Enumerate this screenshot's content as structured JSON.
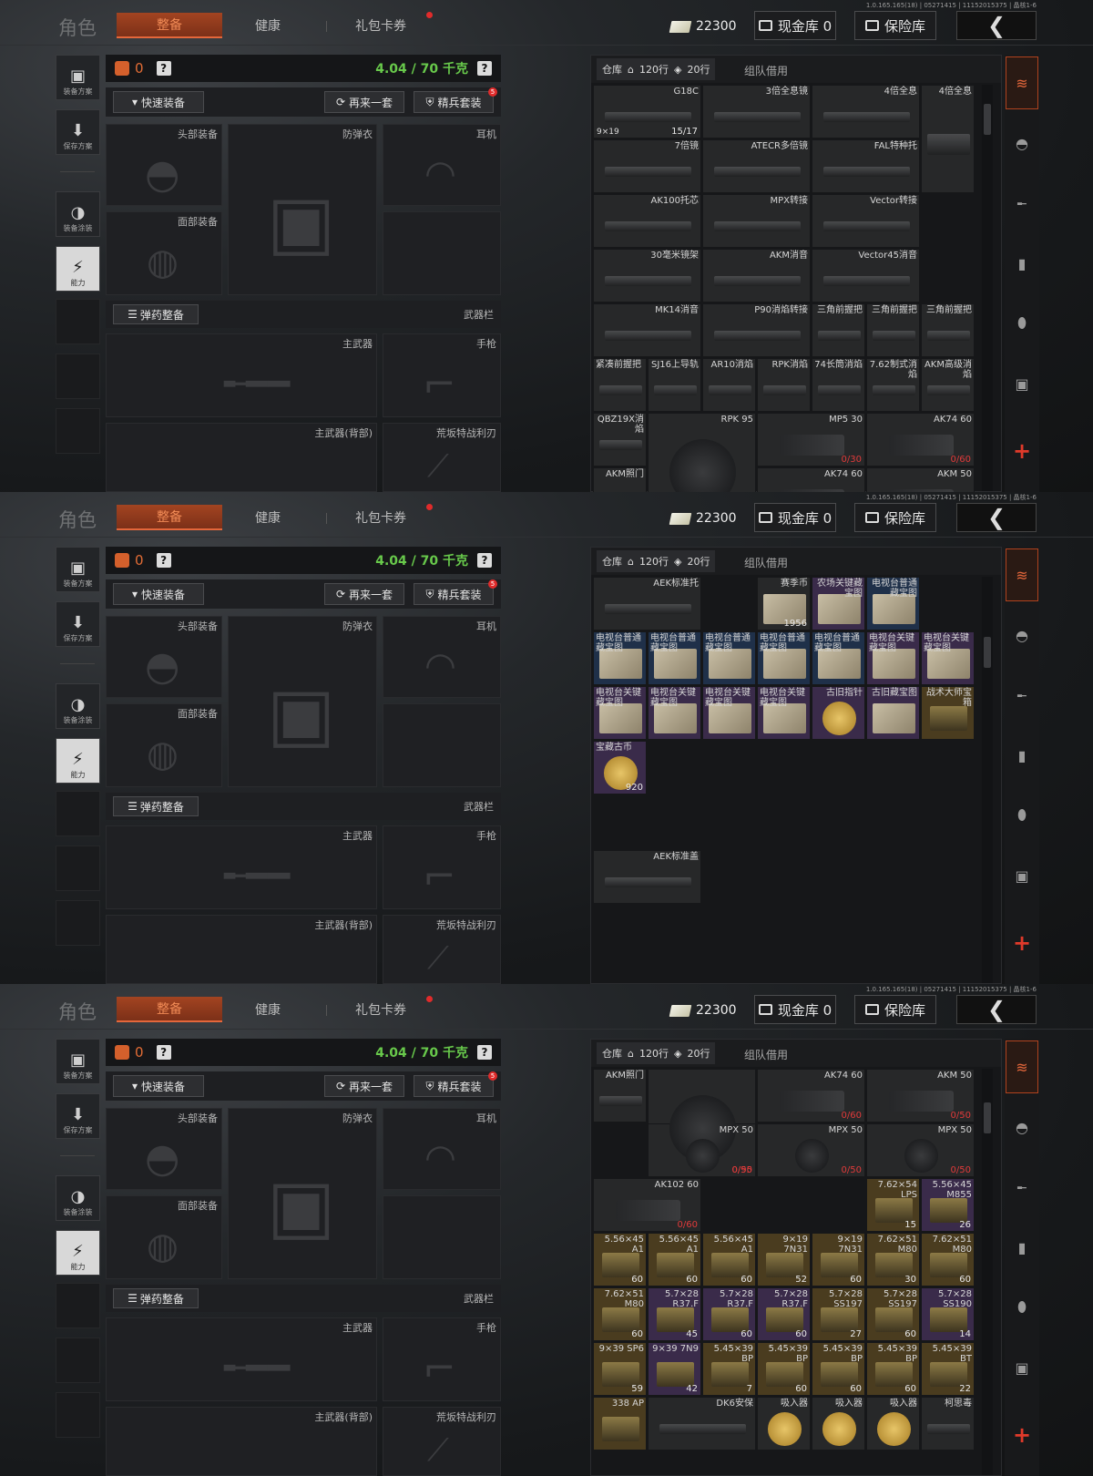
{
  "build_info": "1.0.165.165(18) | 05271415 | 11152015375 | 晶核1-6",
  "header": {
    "title": "角色",
    "tabs": [
      {
        "label": "整备",
        "active": true
      },
      {
        "label": "健康",
        "active": false
      },
      {
        "label": "礼包卡券",
        "active": false,
        "dot": true
      }
    ],
    "money": "22300",
    "cash_vault": "现金库 0",
    "insurance": "保险库",
    "back_icon": "chevron-left-icon"
  },
  "left_menu": {
    "items": [
      "装备方案",
      "保存方案",
      "装备涂装",
      "能力"
    ]
  },
  "loadout": {
    "bag_count": "0",
    "help": "?",
    "weight": "4.04 / 70 千克",
    "quick_equip": "快速装备",
    "repeat": "再来一套",
    "elite_set": "精兵套装",
    "elite_badge": "5",
    "slots": {
      "head": "头部装备",
      "armor": "防弹衣",
      "ear": "耳机",
      "face": "面部装备"
    },
    "ammo_btn": "弹药整备",
    "weapon_bar": "武器栏",
    "primary": "主武器",
    "pistol": "手枪",
    "primary_back": "主武器(背部)",
    "melee": "荒坂特战利刃"
  },
  "stash": {
    "tab": "仓库",
    "rows120": "120行",
    "rows20": "20行",
    "team": "组队借用"
  },
  "screens": [
    {
      "scroll": 0.05,
      "cells": [
        {
          "c": 0,
          "r": 0,
          "w": 2,
          "h": 1,
          "name": "G18C",
          "left": "9×19",
          "count": "15/17",
          "k": "gun"
        },
        {
          "c": 2,
          "r": 0,
          "w": 2,
          "h": 1,
          "name": "3倍全息镜",
          "k": "gun"
        },
        {
          "c": 4,
          "r": 0,
          "w": 2,
          "h": 1,
          "name": "4倍全息",
          "k": "gun"
        },
        {
          "c": 6,
          "r": 0,
          "w": 1,
          "h": 2,
          "name": "4倍全息",
          "k": "gun"
        },
        {
          "c": 0,
          "r": 1,
          "w": 2,
          "h": 1,
          "name": "7倍镜",
          "k": "gun"
        },
        {
          "c": 2,
          "r": 1,
          "w": 2,
          "h": 1,
          "name": "ATECR多倍镜",
          "k": "gun"
        },
        {
          "c": 4,
          "r": 1,
          "w": 2,
          "h": 1,
          "name": "FAL特种托",
          "k": "gun"
        },
        {
          "c": 0,
          "r": 2,
          "w": 2,
          "h": 1,
          "name": "AK100托芯",
          "k": "gun"
        },
        {
          "c": 2,
          "r": 2,
          "w": 2,
          "h": 1,
          "name": "MPX转接",
          "k": "gun"
        },
        {
          "c": 4,
          "r": 2,
          "w": 2,
          "h": 1,
          "name": "Vector转接",
          "k": "gun"
        },
        {
          "c": 0,
          "r": 3,
          "w": 2,
          "h": 1,
          "name": "30毫米镜架",
          "k": "gun"
        },
        {
          "c": 2,
          "r": 3,
          "w": 2,
          "h": 1,
          "name": "AKM消音",
          "k": "gun"
        },
        {
          "c": 4,
          "r": 3,
          "w": 2,
          "h": 1,
          "name": "Vector45消音",
          "k": "gun"
        },
        {
          "c": 0,
          "r": 4,
          "w": 2,
          "h": 1,
          "name": "MK14消音",
          "k": "gun"
        },
        {
          "c": 2,
          "r": 4,
          "w": 2,
          "h": 1,
          "name": "P90消焰转接",
          "k": "gun"
        },
        {
          "c": 4,
          "r": 4,
          "w": 1,
          "h": 1,
          "name": "三角前握把",
          "k": "gun"
        },
        {
          "c": 5,
          "r": 4,
          "w": 1,
          "h": 1,
          "name": "三角前握把",
          "k": "gun"
        },
        {
          "c": 6,
          "r": 4,
          "w": 1,
          "h": 1,
          "name": "三角前握把",
          "k": "gun"
        },
        {
          "c": 0,
          "r": 5,
          "w": 1,
          "h": 1,
          "name": "紧凑前握把",
          "k": "gun",
          "nl": true
        },
        {
          "c": 1,
          "r": 5,
          "w": 1,
          "h": 1,
          "name": "SJ16上导轨",
          "k": "gun"
        },
        {
          "c": 2,
          "r": 5,
          "w": 1,
          "h": 1,
          "name": "AR10消焰",
          "k": "gun"
        },
        {
          "c": 3,
          "r": 5,
          "w": 1,
          "h": 1,
          "name": "RPK消焰",
          "k": "gun"
        },
        {
          "c": 4,
          "r": 5,
          "w": 1,
          "h": 1,
          "name": "74长筒消焰",
          "k": "gun"
        },
        {
          "c": 5,
          "r": 5,
          "w": 1,
          "h": 1,
          "name": "7.62制式消焰",
          "k": "gun"
        },
        {
          "c": 6,
          "r": 5,
          "w": 1,
          "h": 1,
          "name": "AKM高级消焰",
          "k": "gun"
        },
        {
          "c": 0,
          "r": 6,
          "w": 1,
          "h": 1,
          "name": "QBZ19X消焰",
          "k": "gun"
        },
        {
          "c": 1,
          "r": 6,
          "w": 2,
          "h": 2,
          "name": "RPK 95",
          "k": "drum"
        },
        {
          "c": 3,
          "r": 6,
          "w": 2,
          "h": 1,
          "name": "MP5 30",
          "count": "0/30",
          "red": true,
          "k": "mag"
        },
        {
          "c": 5,
          "r": 6,
          "w": 2,
          "h": 1,
          "name": "AK74 60",
          "count": "0/60",
          "red": true,
          "k": "mag"
        },
        {
          "c": 0,
          "r": 7,
          "w": 1,
          "h": 1,
          "name": "AKM照门",
          "k": "gun"
        },
        {
          "c": 3,
          "r": 7,
          "w": 2,
          "h": 1,
          "name": "AK74 60",
          "k": "mag"
        },
        {
          "c": 5,
          "r": 7,
          "w": 2,
          "h": 1,
          "name": "AKM 50",
          "k": "mag"
        }
      ]
    },
    {
      "scroll": 0.16,
      "cells": [
        {
          "c": 0,
          "r": 0,
          "w": 2,
          "h": 1,
          "name": "AEK标准托",
          "k": "gun"
        },
        {
          "c": 3,
          "r": 0,
          "w": 1,
          "h": 1,
          "name": "赛季币",
          "count": "1956",
          "k": "map"
        },
        {
          "c": 4,
          "r": 0,
          "w": 1,
          "h": 1,
          "name": "农场关键藏宝图",
          "k": "map",
          "t": "purple"
        },
        {
          "c": 5,
          "r": 0,
          "w": 1,
          "h": 1,
          "name": "电视台普通藏宝图",
          "k": "map",
          "t": "blue"
        },
        {
          "c": 0,
          "r": 1,
          "w": 1,
          "h": 1,
          "name": "电视台普通藏宝图",
          "k": "map",
          "t": "blue",
          "nl": true
        },
        {
          "c": 1,
          "r": 1,
          "w": 1,
          "h": 1,
          "name": "电视台普通藏宝图",
          "k": "map",
          "t": "blue",
          "nl": true
        },
        {
          "c": 2,
          "r": 1,
          "w": 1,
          "h": 1,
          "name": "电视台普通藏宝图",
          "k": "map",
          "t": "blue",
          "nl": true
        },
        {
          "c": 3,
          "r": 1,
          "w": 1,
          "h": 1,
          "name": "电视台普通藏宝图",
          "k": "map",
          "t": "blue",
          "nl": true
        },
        {
          "c": 4,
          "r": 1,
          "w": 1,
          "h": 1,
          "name": "电视台普通藏宝图",
          "k": "map",
          "t": "blue",
          "nl": true
        },
        {
          "c": 5,
          "r": 1,
          "w": 1,
          "h": 1,
          "name": "电视台关键藏宝图",
          "k": "map",
          "t": "purple",
          "nl": true
        },
        {
          "c": 6,
          "r": 1,
          "w": 1,
          "h": 1,
          "name": "电视台关键藏宝图",
          "k": "map",
          "t": "purple",
          "nl": true
        },
        {
          "c": 0,
          "r": 2,
          "w": 1,
          "h": 1,
          "name": "电视台关键藏宝图",
          "k": "map",
          "t": "purple",
          "nl": true
        },
        {
          "c": 1,
          "r": 2,
          "w": 1,
          "h": 1,
          "name": "电视台关键藏宝图",
          "k": "map",
          "t": "purple",
          "nl": true
        },
        {
          "c": 2,
          "r": 2,
          "w": 1,
          "h": 1,
          "name": "电视台关键藏宝图",
          "k": "map",
          "t": "purple",
          "nl": true
        },
        {
          "c": 3,
          "r": 2,
          "w": 1,
          "h": 1,
          "name": "电视台关键藏宝图",
          "k": "map",
          "t": "purple",
          "nl": true
        },
        {
          "c": 4,
          "r": 2,
          "w": 1,
          "h": 1,
          "name": "古旧指针",
          "k": "coin",
          "t": "purple"
        },
        {
          "c": 5,
          "r": 2,
          "w": 1,
          "h": 1,
          "name": "古旧藏宝图",
          "k": "map",
          "t": "purple"
        },
        {
          "c": 6,
          "r": 2,
          "w": 1,
          "h": 1,
          "name": "战术大师宝箱",
          "k": "ammo",
          "t": "gold"
        },
        {
          "c": 0,
          "r": 3,
          "w": 1,
          "h": 1,
          "name": "宝藏古币",
          "count": "920",
          "k": "coin",
          "t": "purple",
          "nl": true
        },
        {
          "c": 0,
          "r": 5,
          "w": 2,
          "h": 1,
          "name": "AEK标准盖",
          "k": "gun"
        }
      ]
    },
    {
      "scroll": 0.09,
      "cells": [
        {
          "c": 1,
          "r": 0,
          "w": 2,
          "h": 2,
          "name": "",
          "count": "0/95",
          "red": true,
          "k": "drum"
        },
        {
          "c": 3,
          "r": 0,
          "w": 2,
          "h": 1,
          "name": "AK74 60",
          "count": "0/60",
          "red": true,
          "k": "mag"
        },
        {
          "c": 5,
          "r": 0,
          "w": 2,
          "h": 1,
          "name": "AKM 50",
          "count": "0/50",
          "red": true,
          "k": "mag"
        },
        {
          "c": 0,
          "r": 0,
          "w": 1,
          "h": 1,
          "name": "AKM照门",
          "k": "gun"
        },
        {
          "c": 1,
          "r": 1,
          "w": 2,
          "h": 1,
          "name": "MPX 50",
          "count": "0/50",
          "red": true,
          "k": "drum"
        },
        {
          "c": 3,
          "r": 1,
          "w": 2,
          "h": 1,
          "name": "MPX 50",
          "count": "0/50",
          "red": true,
          "k": "drum"
        },
        {
          "c": 5,
          "r": 1,
          "w": 2,
          "h": 1,
          "name": "MPX 50",
          "count": "0/50",
          "red": true,
          "k": "drum"
        },
        {
          "c": 0,
          "r": 2,
          "w": 2,
          "h": 1,
          "name": "AK102 60",
          "count": "0/60",
          "red": true,
          "k": "mag"
        },
        {
          "c": 5,
          "r": 2,
          "w": 1,
          "h": 1,
          "name": "7.62×54 LPS",
          "count": "15",
          "k": "ammo",
          "t": "gold"
        },
        {
          "c": 6,
          "r": 2,
          "w": 1,
          "h": 1,
          "name": "5.56×45 M855",
          "count": "26",
          "k": "ammo",
          "t": "purple"
        },
        {
          "c": 0,
          "r": 3,
          "w": 1,
          "h": 1,
          "name": "5.56×45 A1",
          "count": "60",
          "k": "ammo",
          "t": "gold"
        },
        {
          "c": 1,
          "r": 3,
          "w": 1,
          "h": 1,
          "name": "5.56×45 A1",
          "count": "60",
          "k": "ammo",
          "t": "gold"
        },
        {
          "c": 2,
          "r": 3,
          "w": 1,
          "h": 1,
          "name": "5.56×45 A1",
          "count": "60",
          "k": "ammo",
          "t": "gold"
        },
        {
          "c": 3,
          "r": 3,
          "w": 1,
          "h": 1,
          "name": "9×19 7N31",
          "count": "52",
          "k": "ammo",
          "t": "gold"
        },
        {
          "c": 4,
          "r": 3,
          "w": 1,
          "h": 1,
          "name": "9×19 7N31",
          "count": "60",
          "k": "ammo",
          "t": "gold"
        },
        {
          "c": 5,
          "r": 3,
          "w": 1,
          "h": 1,
          "name": "7.62×51 M80",
          "count": "30",
          "k": "ammo",
          "t": "gold"
        },
        {
          "c": 6,
          "r": 3,
          "w": 1,
          "h": 1,
          "name": "7.62×51 M80",
          "count": "60",
          "k": "ammo",
          "t": "gold"
        },
        {
          "c": 0,
          "r": 4,
          "w": 1,
          "h": 1,
          "name": "7.62×51 M80",
          "count": "60",
          "k": "ammo",
          "t": "gold"
        },
        {
          "c": 1,
          "r": 4,
          "w": 1,
          "h": 1,
          "name": "5.7×28 R37.F",
          "count": "45",
          "k": "ammo",
          "t": "purple"
        },
        {
          "c": 2,
          "r": 4,
          "w": 1,
          "h": 1,
          "name": "5.7×28 R37.F",
          "count": "60",
          "k": "ammo",
          "t": "purple"
        },
        {
          "c": 3,
          "r": 4,
          "w": 1,
          "h": 1,
          "name": "5.7×28 R37.F",
          "count": "60",
          "k": "ammo",
          "t": "purple"
        },
        {
          "c": 4,
          "r": 4,
          "w": 1,
          "h": 1,
          "name": "5.7×28 SS197",
          "count": "27",
          "k": "ammo",
          "t": "gold"
        },
        {
          "c": 5,
          "r": 4,
          "w": 1,
          "h": 1,
          "name": "5.7×28 SS197",
          "count": "60",
          "k": "ammo",
          "t": "gold"
        },
        {
          "c": 6,
          "r": 4,
          "w": 1,
          "h": 1,
          "name": "5.7×28 SS190",
          "count": "14",
          "k": "ammo",
          "t": "purple"
        },
        {
          "c": 0,
          "r": 5,
          "w": 1,
          "h": 1,
          "name": "9×39 SP6",
          "count": "59",
          "k": "ammo",
          "t": "gold"
        },
        {
          "c": 1,
          "r": 5,
          "w": 1,
          "h": 1,
          "name": "9×39 7N9",
          "count": "42",
          "k": "ammo",
          "t": "purple"
        },
        {
          "c": 2,
          "r": 5,
          "w": 1,
          "h": 1,
          "name": "5.45×39 BP",
          "count": "7",
          "k": "ammo",
          "t": "gold"
        },
        {
          "c": 3,
          "r": 5,
          "w": 1,
          "h": 1,
          "name": "5.45×39 BP",
          "count": "60",
          "k": "ammo",
          "t": "gold"
        },
        {
          "c": 4,
          "r": 5,
          "w": 1,
          "h": 1,
          "name": "5.45×39 BP",
          "count": "60",
          "k": "ammo",
          "t": "gold"
        },
        {
          "c": 5,
          "r": 5,
          "w": 1,
          "h": 1,
          "name": "5.45×39 BP",
          "count": "60",
          "k": "ammo",
          "t": "gold"
        },
        {
          "c": 6,
          "r": 5,
          "w": 1,
          "h": 1,
          "name": "5.45×39 BT",
          "count": "22",
          "k": "ammo",
          "t": "gold"
        },
        {
          "c": 0,
          "r": 6,
          "w": 1,
          "h": 1,
          "name": "338 AP",
          "k": "ammo",
          "t": "gold"
        },
        {
          "c": 1,
          "r": 6,
          "w": 2,
          "h": 1,
          "name": "DK6安保",
          "k": "gun"
        },
        {
          "c": 3,
          "r": 6,
          "w": 1,
          "h": 1,
          "name": "吸入器",
          "k": "coin"
        },
        {
          "c": 4,
          "r": 6,
          "w": 1,
          "h": 1,
          "name": "吸入器",
          "k": "coin"
        },
        {
          "c": 5,
          "r": 6,
          "w": 1,
          "h": 1,
          "name": "吸入器",
          "k": "coin"
        },
        {
          "c": 6,
          "r": 6,
          "w": 1,
          "h": 1,
          "name": "柯思毒",
          "k": "gun"
        }
      ]
    }
  ],
  "rail_icons": [
    "stash-stack-icon",
    "helmet-icon",
    "rifle-icon",
    "magazine-icon",
    "bullet-icon",
    "vest-icon"
  ],
  "colors": {
    "accent": "#e4673b",
    "weight": "#68c94b",
    "alert": "#e02b2b"
  }
}
